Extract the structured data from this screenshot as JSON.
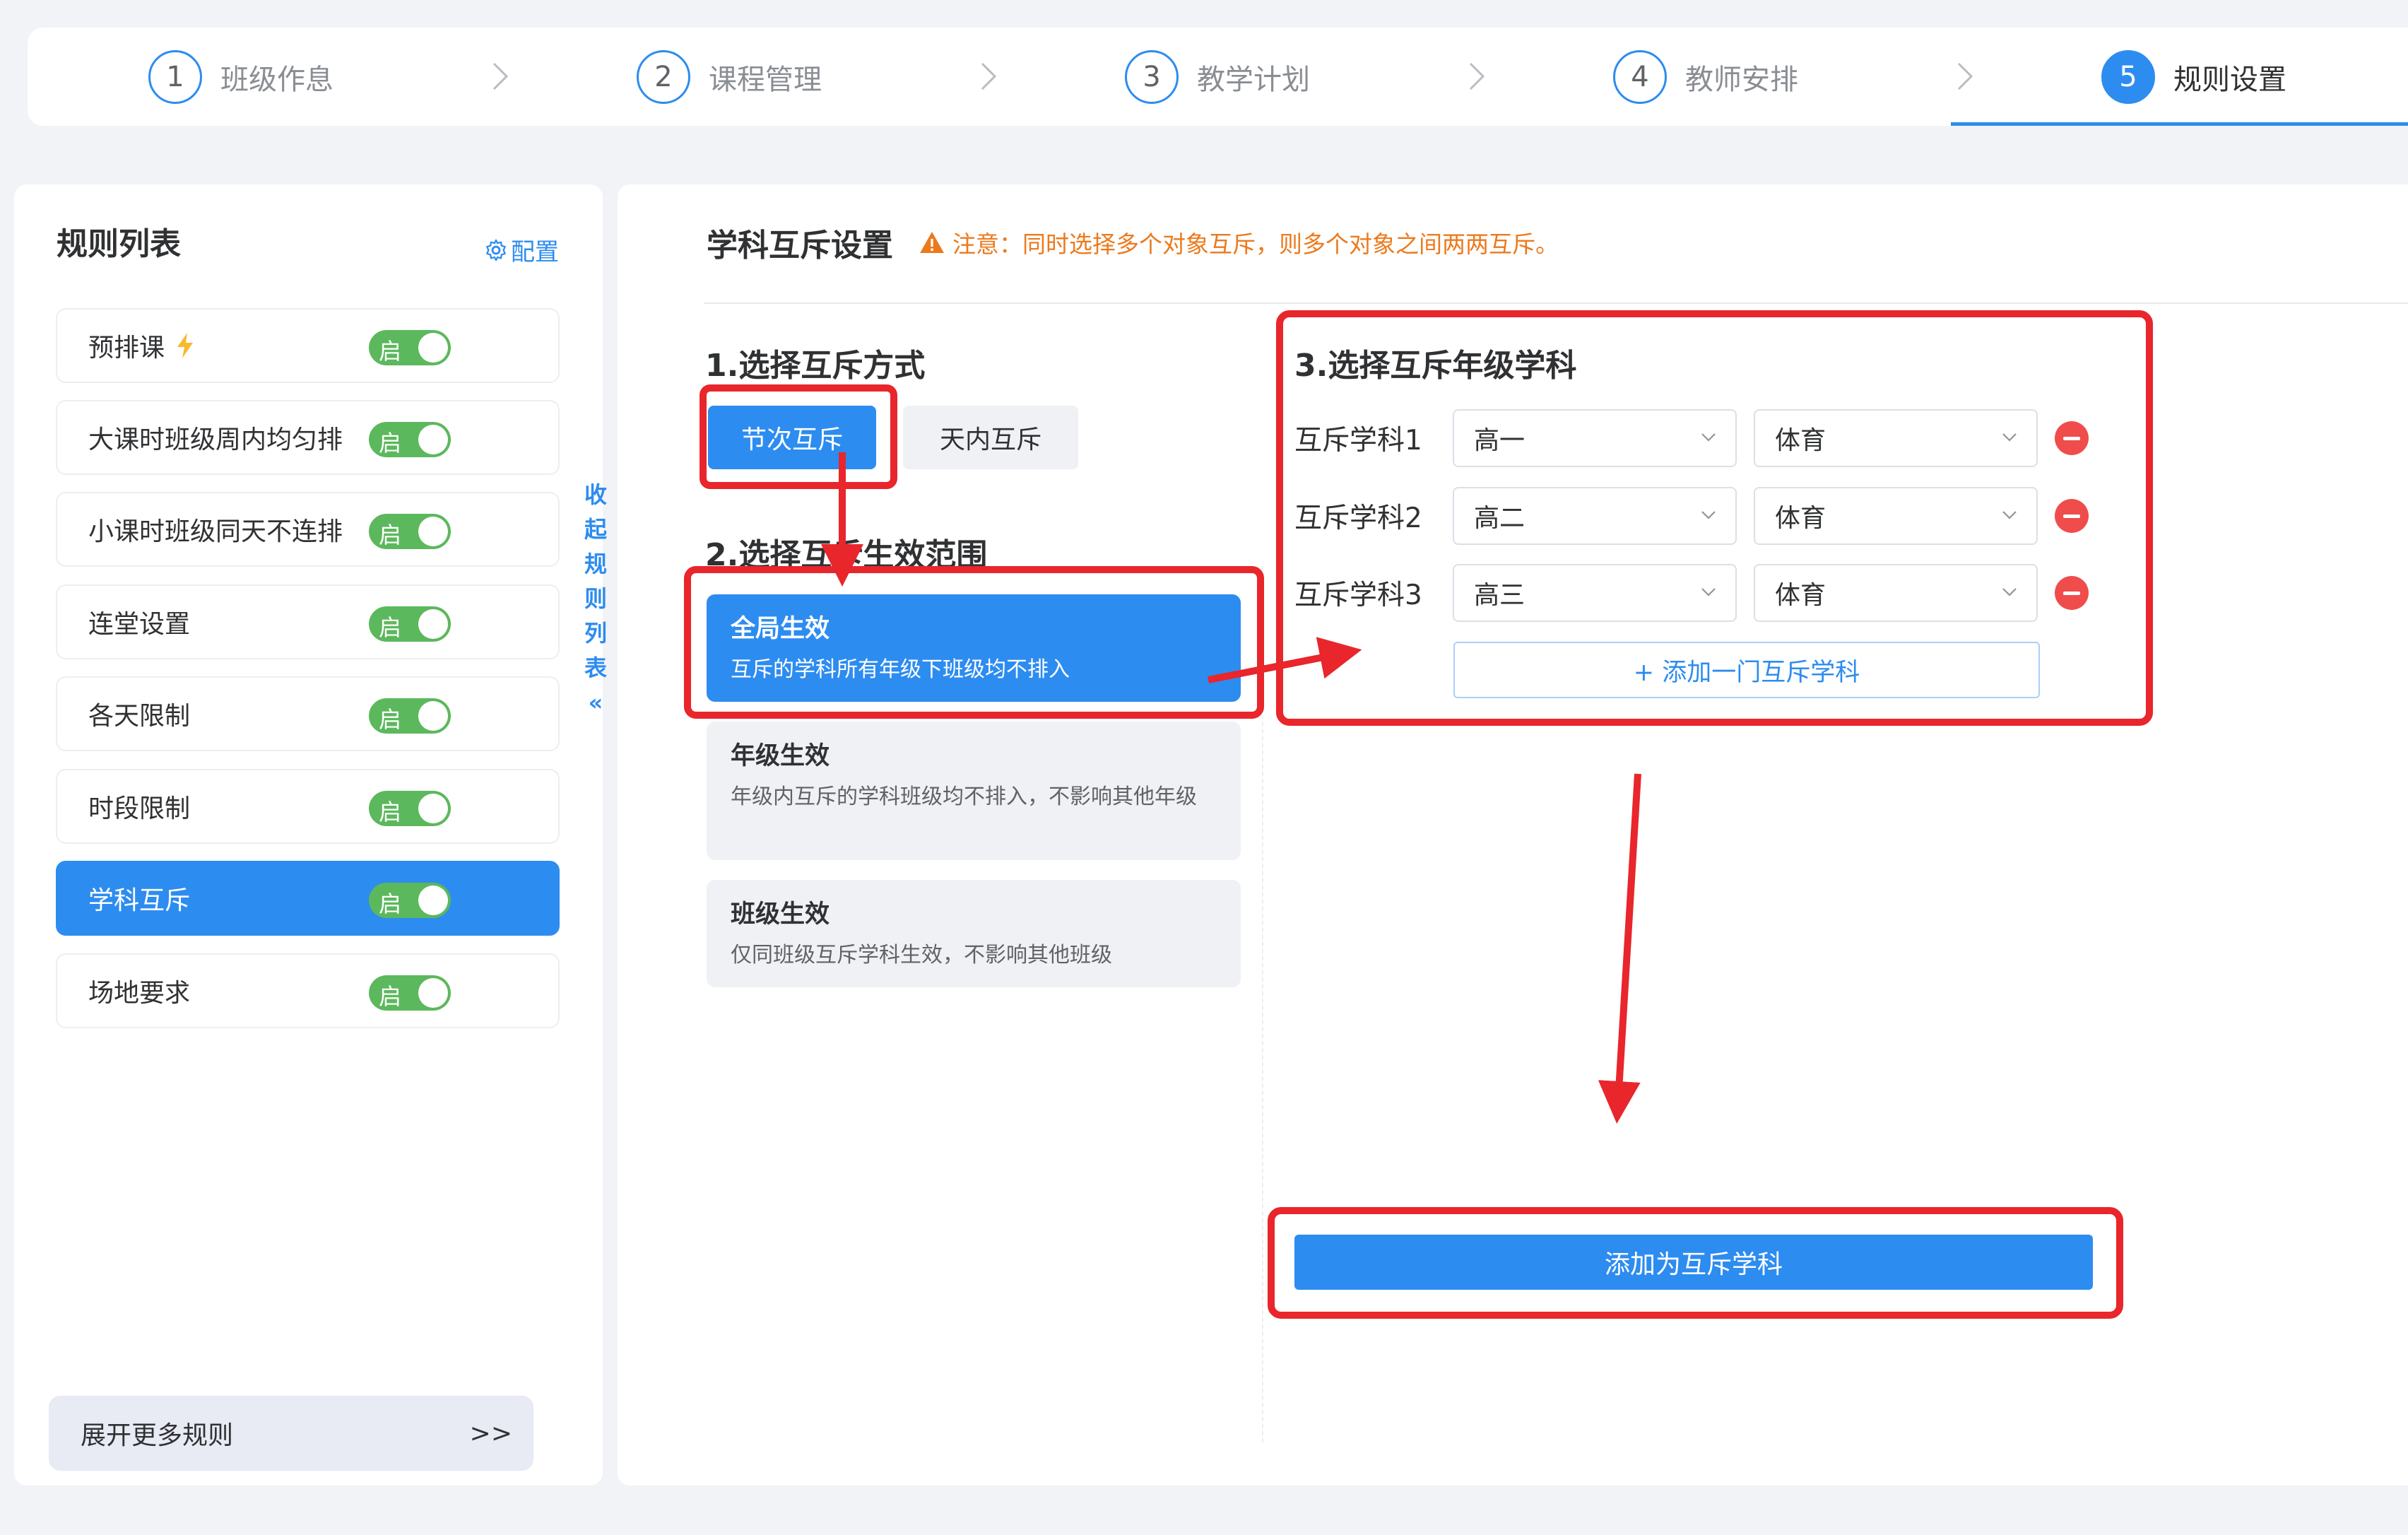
{
  "steps": [
    {
      "num": "1",
      "label": "班级作息"
    },
    {
      "num": "2",
      "label": "课程管理"
    },
    {
      "num": "3",
      "label": "教学计划"
    },
    {
      "num": "4",
      "label": "教师安排"
    },
    {
      "num": "5",
      "label": "规则设置"
    }
  ],
  "active_step": 5,
  "sidebar": {
    "title": "规则列表",
    "config_label": "配置",
    "toggle_text": "启",
    "rules": [
      {
        "label": "预排课",
        "has_bolt": true,
        "enabled": true
      },
      {
        "label": "大课时班级周内均匀排",
        "enabled": true
      },
      {
        "label": "小课时班级同天不连排",
        "enabled": true
      },
      {
        "label": "连堂设置",
        "enabled": true
      },
      {
        "label": "各天限制",
        "enabled": true
      },
      {
        "label": "时段限制",
        "enabled": true
      },
      {
        "label": "学科互斥",
        "enabled": true,
        "selected": true
      },
      {
        "label": "场地要求",
        "enabled": true
      }
    ],
    "collapse_chars": [
      "收",
      "起",
      "规",
      "则",
      "列",
      "表",
      "«"
    ],
    "expand_label": "展开更多规则",
    "expand_arrow": ">>"
  },
  "main": {
    "title": "学科互斥设置",
    "notice": "注意：同时选择多个对象互斥，则多个对象之间两两互斥。",
    "section1": "1.选择互斥方式",
    "mode_options": [
      "节次互斥",
      "天内互斥"
    ],
    "selected_mode": "节次互斥",
    "section2": "2.选择互斥生效范围",
    "scopes": [
      {
        "title": "全局生效",
        "desc": "互斥的学科所有年级下班级均不排入",
        "selected": true
      },
      {
        "title": "年级生效",
        "desc": "年级内互斥的学科班级均不排入，不影响其他年级"
      },
      {
        "title": "班级生效",
        "desc": "仅同班级互斥学科生效，不影响其他班级"
      }
    ],
    "section3": "3.选择互斥年级学科",
    "mutex_rows": [
      {
        "label": "互斥学科1",
        "grade": "高一",
        "subject": "体育"
      },
      {
        "label": "互斥学科2",
        "grade": "高二",
        "subject": "体育"
      },
      {
        "label": "互斥学科3",
        "grade": "高三",
        "subject": "体育"
      }
    ],
    "add_subject_label": "+ 添加一门互斥学科",
    "submit_label": "添加为互斥学科"
  },
  "colors": {
    "primary": "#2d8cf0",
    "toggle_on": "#5cb85c",
    "warning": "#ec7a1d",
    "remove": "#f04c4c",
    "annotation": "#e8262b"
  }
}
